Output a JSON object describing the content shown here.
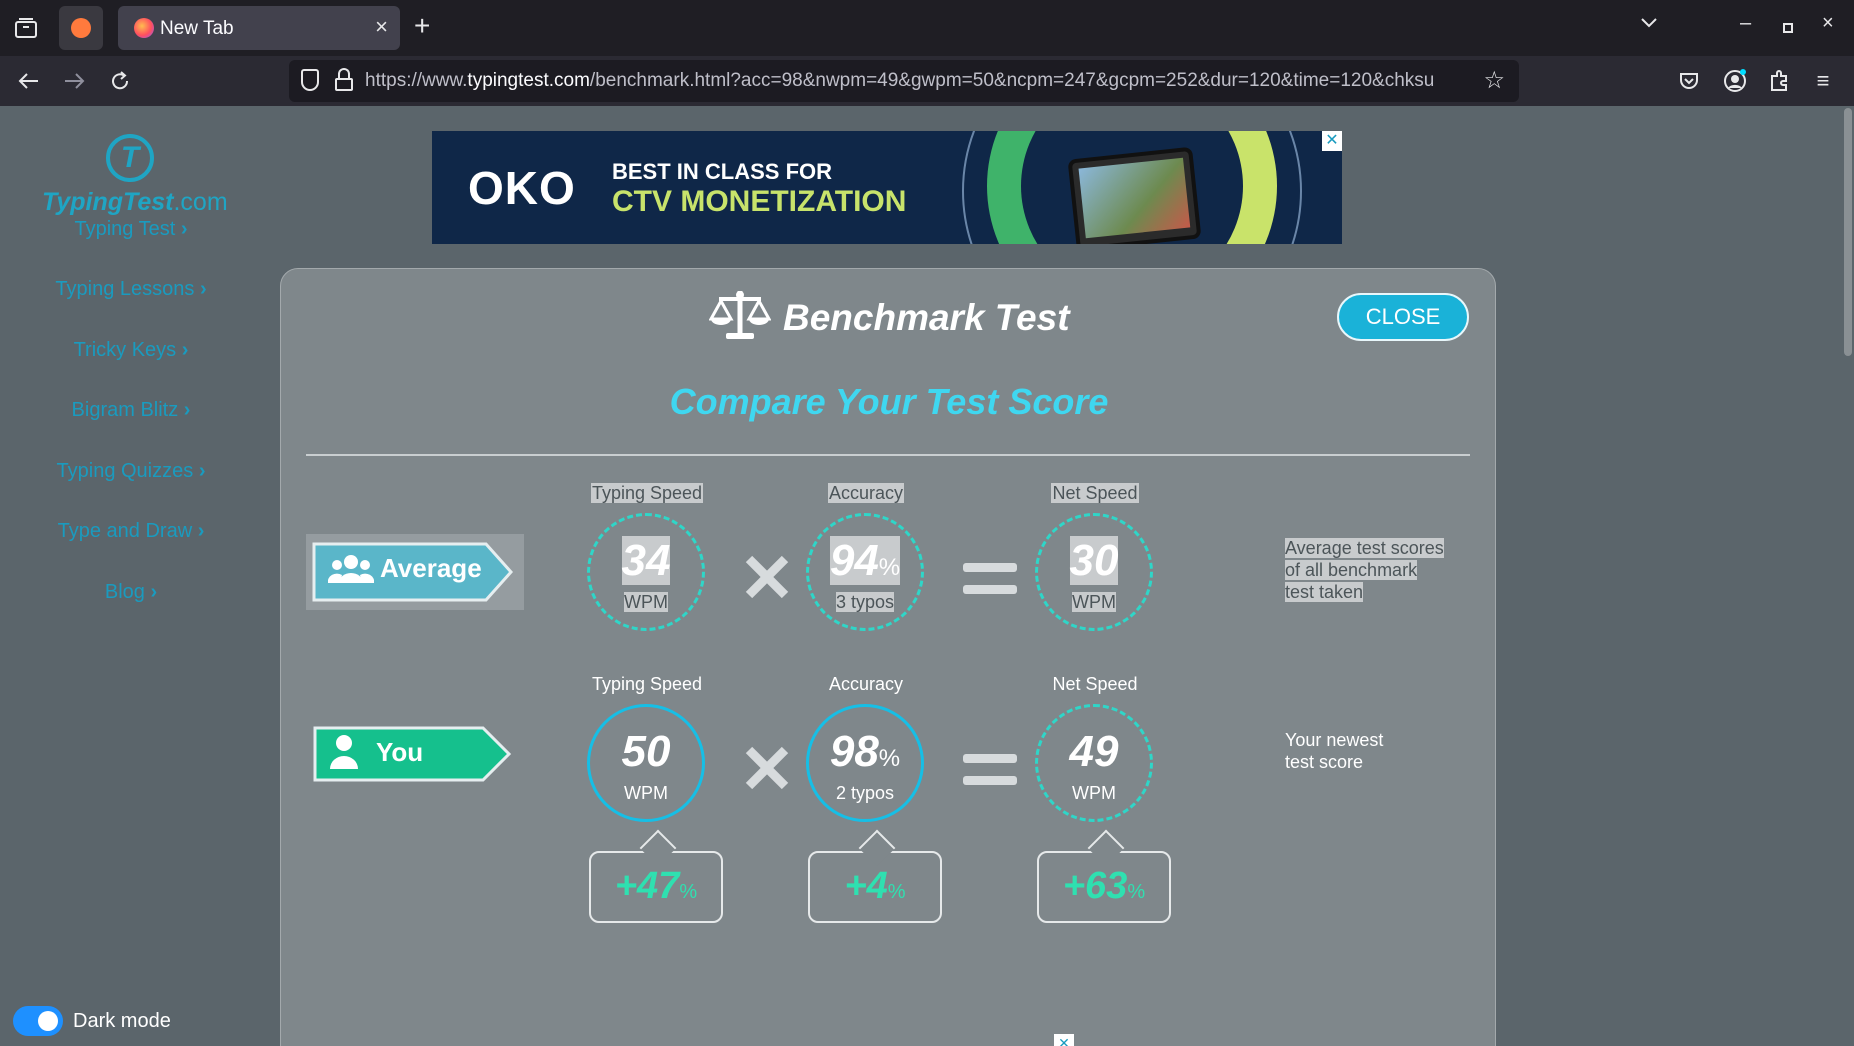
{
  "browser": {
    "tab_title": "New Tab",
    "url_prefix": "https://www.",
    "url_domain": "typingtest.com",
    "url_path": "/benchmark.html?acc=98&nwpm=49&gwpm=50&ncpm=247&gcpm=252&dur=120&time=120&chksu"
  },
  "sidebar": {
    "logo_main": "TypingTest",
    "logo_suffix": ".com",
    "items": [
      {
        "label": "Typing Test"
      },
      {
        "label": "Typing Lessons"
      },
      {
        "label": "Tricky Keys"
      },
      {
        "label": "Bigram Blitz"
      },
      {
        "label": "Typing Quizzes"
      },
      {
        "label": "Type and Draw"
      },
      {
        "label": "Blog"
      }
    ],
    "dark_mode_label": "Dark mode",
    "dark_mode_on": true
  },
  "ad": {
    "brand": "OKO",
    "line1": "BEST IN CLASS FOR",
    "line2": "CTV MONETIZATION"
  },
  "modal": {
    "title": "Benchmark Test",
    "close_label": "CLOSE",
    "subtitle": "Compare Your Test Score",
    "average": {
      "badge": "Average",
      "speed_label": "Typing Speed",
      "speed": "34",
      "speed_unit": "WPM",
      "acc_label": "Accuracy",
      "acc": "94",
      "acc_sub": "3 typos",
      "net_label": "Net Speed",
      "net": "30",
      "net_unit": "WPM",
      "note": [
        "Average test scores",
        "of all benchmark",
        "test taken"
      ]
    },
    "you": {
      "badge": "You",
      "speed_label": "Typing Speed",
      "speed": "50",
      "speed_unit": "WPM",
      "acc_label": "Accuracy",
      "acc": "98",
      "acc_sub": "2 typos",
      "net_label": "Net Speed",
      "net": "49",
      "net_unit": "WPM",
      "note": [
        "Your newest",
        "test score"
      ]
    },
    "deltas": {
      "speed": "+47",
      "acc": "+4",
      "net": "+63"
    },
    "percent_sign": "%"
  },
  "colors": {
    "accent": "#1ab2d8",
    "teal": "#2fd6c8",
    "you_badge": "#15c08d",
    "average_badge": "#5ab6c9"
  }
}
